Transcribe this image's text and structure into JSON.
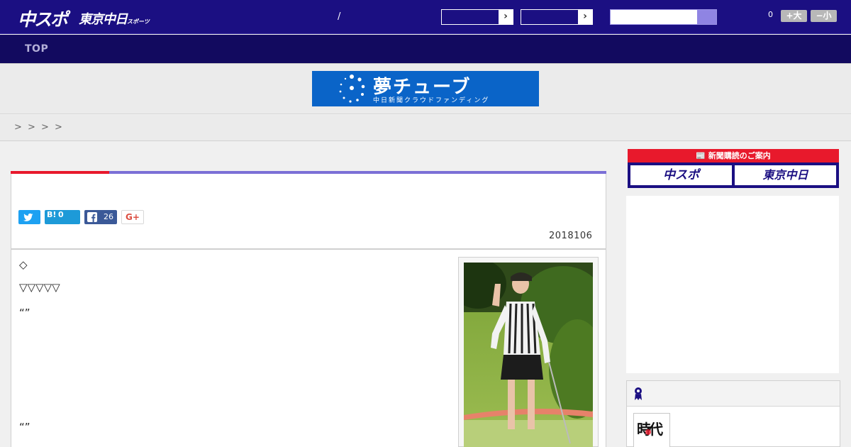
{
  "header": {
    "logo_main": "中スポ",
    "logo_sub": "東京中日",
    "logo_sub_small": "スポーツ",
    "separator": "/",
    "search_placeholder": "",
    "font_size_value": "0",
    "font_up_label": "+大",
    "font_down_label": "−小"
  },
  "nav": {
    "items": [
      {
        "label": "TOP"
      }
    ]
  },
  "banner": {
    "title": "夢チューブ",
    "subtitle": "中日新聞クラウドファンディング",
    "colors": {
      "background": "#0a64c8"
    }
  },
  "breadcrumb": {
    "separators": [
      ">",
      ">",
      ">",
      ">"
    ]
  },
  "article": {
    "share": {
      "hatena_label": "B!",
      "hatena_count": "0",
      "facebook_count": "26",
      "gplus_label": "G+"
    },
    "date": "2018106",
    "body": {
      "line1": "◇",
      "line2": "▽▽▽▽▽",
      "line3": "“”",
      "line4": "“”"
    }
  },
  "sidebar": {
    "subscription": {
      "heading": "新聞購読のご案内",
      "option_1": "中スポ",
      "option_2": "東京中日"
    },
    "ranking_thumb_text": "時代"
  },
  "colors": {
    "header_bg": "#1b0f82",
    "nav_bg": "#120a5f",
    "accent_red": "#e8192c",
    "accent_purple": "#7b6fd6"
  }
}
